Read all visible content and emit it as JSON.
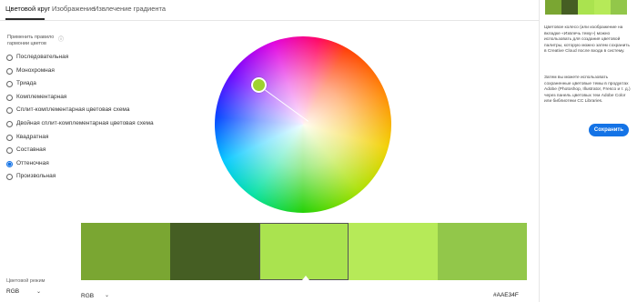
{
  "tabs": [
    {
      "label": "Цветовой круг",
      "active": true
    },
    {
      "label": "Изображение",
      "active": false
    },
    {
      "label": "Извлечение градиента",
      "active": false
    }
  ],
  "rules": {
    "heading": "Применить правило гармонии цветов",
    "items": [
      {
        "label": "Последовательная",
        "checked": false
      },
      {
        "label": "Монохромная",
        "checked": false
      },
      {
        "label": "Триада",
        "checked": false
      },
      {
        "label": "Комплементарная",
        "checked": false
      },
      {
        "label": "Сплит-комплементарная цветовая схема",
        "checked": false
      },
      {
        "label": "Двойная сплит-комплементарная цветовая схема",
        "checked": false
      },
      {
        "label": "Квадратная",
        "checked": false
      },
      {
        "label": "Составная",
        "checked": false
      },
      {
        "label": "Оттеночная",
        "checked": true
      },
      {
        "label": "Произвольная",
        "checked": false
      }
    ]
  },
  "swatches": [
    "#7aa632",
    "#455e23",
    "#aae34f",
    "#b6ea58",
    "#92c74a"
  ],
  "active_swatch_index": 2,
  "color_mode": {
    "label": "Цветовой режим",
    "value": "RGB"
  },
  "bottom_mode": "RGB",
  "hex_value": "#AAE34F",
  "side": {
    "mini_colors": [
      "#7aa632",
      "#455e23",
      "#aae34f",
      "#b6ea58",
      "#92c74a"
    ],
    "text1": "Цветовое колесо (или изображение на вкладке «Извлечь тему») можно использовать для создания цветовой палитры, которую можно затем сохранить в Creative Cloud после входа в систему.",
    "text2": "Затем вы можете использовать сохраненные цветовые темы в продуктах Adobe (Photoshop, Illustrator, Fresco и т. д.) через панель цветовых тем Adobe Color или библиотеки CC Libraries.",
    "save_label": "Сохранить"
  }
}
